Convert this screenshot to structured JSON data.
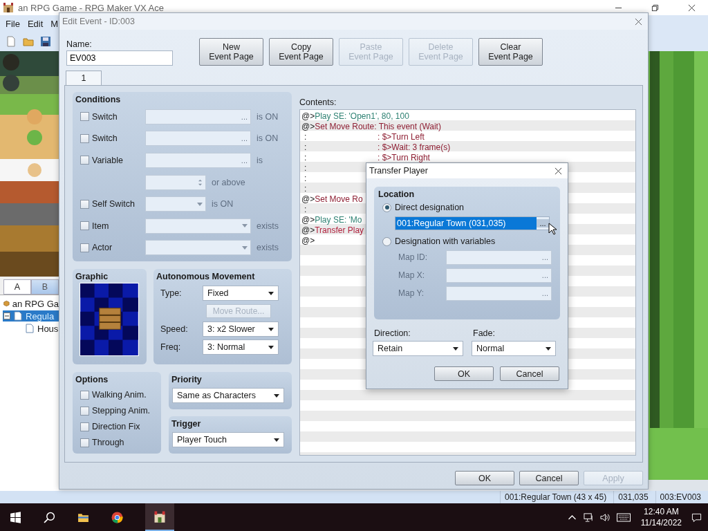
{
  "app_window": {
    "title": "an RPG Game - RPG Maker VX Ace",
    "menu": [
      "File",
      "Edit",
      "M"
    ]
  },
  "tileset_tabs": [
    {
      "label": "A",
      "selected": true
    },
    {
      "label": "B",
      "selected": false
    }
  ],
  "map_tree": [
    {
      "label": "an RPG Ga",
      "selected": false,
      "children": [
        {
          "label": "Regula",
          "selected": true,
          "expanded": true,
          "children": [
            {
              "label": "Hous",
              "selected": false
            }
          ]
        }
      ]
    }
  ],
  "edit_event": {
    "title": "Edit Event - ID:003",
    "name_label": "Name:",
    "name": "EV003",
    "page_buttons": [
      {
        "lines": [
          "New",
          "Event Page"
        ],
        "disabled": false
      },
      {
        "lines": [
          "Copy",
          "Event Page"
        ],
        "disabled": false
      },
      {
        "lines": [
          "Paste",
          "Event Page"
        ],
        "disabled": true
      },
      {
        "lines": [
          "Delete",
          "Event Page"
        ],
        "disabled": true
      },
      {
        "lines": [
          "Clear",
          "Event Page"
        ],
        "disabled": false
      }
    ],
    "page_tabs": [
      {
        "label": "1",
        "selected": true
      }
    ],
    "conditions": {
      "title": "Conditions",
      "rows": [
        {
          "kind": "picker",
          "label": "Switch",
          "checked": false,
          "button": "...",
          "suffix": "is ON"
        },
        {
          "kind": "picker",
          "label": "Switch",
          "checked": false,
          "button": "...",
          "suffix": "is ON"
        },
        {
          "kind": "picker",
          "label": "Variable",
          "checked": false,
          "button": "...",
          "suffix": "is"
        },
        {
          "kind": "spin",
          "suffix": "or above"
        },
        {
          "kind": "dropdown_short",
          "label": "Self Switch",
          "checked": false,
          "suffix": "is ON"
        },
        {
          "kind": "dropdown",
          "label": "Item",
          "checked": false,
          "suffix": "exists"
        },
        {
          "kind": "dropdown",
          "label": "Actor",
          "checked": false,
          "suffix": "exists"
        }
      ]
    },
    "graphic": {
      "title": "Graphic"
    },
    "movement": {
      "title": "Autonomous Movement",
      "type_label": "Type:",
      "type": "Fixed",
      "route_button": {
        "label": "Move Route...",
        "disabled": true
      },
      "speed_label": "Speed:",
      "speed": "3: x2 Slower",
      "freq_label": "Freq:",
      "freq": "3: Normal"
    },
    "options": {
      "title": "Options",
      "items": [
        {
          "label": "Walking Anim.",
          "checked": false
        },
        {
          "label": "Stepping Anim.",
          "checked": false
        },
        {
          "label": "Direction Fix",
          "checked": false
        },
        {
          "label": "Through",
          "checked": false
        }
      ]
    },
    "priority": {
      "title": "Priority",
      "value": "Same as Characters"
    },
    "trigger": {
      "title": "Trigger",
      "value": "Player Touch"
    },
    "contents": {
      "label": "Contents:",
      "lines": [
        {
          "kind": "command",
          "lead": "@>",
          "text": "Play SE: 'Open1', 80, 100",
          "color": "#2f8273"
        },
        {
          "kind": "command",
          "lead": "@>",
          "text": "Set Move Route: This event (Wait)",
          "color": "#8e1f33"
        },
        {
          "kind": "step",
          "lead": ":",
          "text": ": $>Turn Left",
          "color": "#8e1f33"
        },
        {
          "kind": "step",
          "lead": ":",
          "text": ": $>Wait: 3 frame(s)",
          "color": "#8e1f33"
        },
        {
          "kind": "step",
          "lead": ":",
          "text": ": $>Turn Right",
          "color": "#8e1f33"
        },
        {
          "kind": "step",
          "lead": ":"
        },
        {
          "kind": "step",
          "lead": ":"
        },
        {
          "kind": "step",
          "lead": ":"
        },
        {
          "kind": "command",
          "lead": "@>",
          "text": "Set Move Ro",
          "color": "#8e1f33"
        },
        {
          "kind": "step",
          "lead": ":"
        },
        {
          "kind": "command",
          "lead": "@>",
          "text": "Play SE: 'Mo",
          "color": "#2f8273"
        },
        {
          "kind": "command",
          "lead": "@>",
          "text": "Transfer Play",
          "color": "#b0203c"
        },
        {
          "kind": "command",
          "lead": "@>"
        }
      ]
    },
    "buttons": [
      {
        "label": "OK",
        "disabled": false
      },
      {
        "label": "Cancel",
        "disabled": false
      },
      {
        "label": "Apply",
        "disabled": true
      }
    ]
  },
  "transfer_player": {
    "title": "Transfer Player",
    "location_title": "Location",
    "modes": [
      {
        "label": "Direct designation",
        "selected": true
      },
      {
        "label": "Designation with variables",
        "selected": false
      }
    ],
    "map_value": "001:Regular Town (031,035)",
    "map_button": "...",
    "var_fields": [
      {
        "label": "Map ID:",
        "button": "..."
      },
      {
        "label": "Map X:",
        "button": "..."
      },
      {
        "label": "Map Y:",
        "button": "..."
      }
    ],
    "direction_label": "Direction:",
    "direction": "Retain",
    "fade_label": "Fade:",
    "fade": "Normal",
    "buttons": [
      "OK",
      "Cancel"
    ]
  },
  "status_bar": [
    "001:Regular Town (43 x 45)",
    "031,035",
    "003:EV003"
  ],
  "taskbar": {
    "time": "12:40 AM",
    "date": "11/14/2022"
  }
}
